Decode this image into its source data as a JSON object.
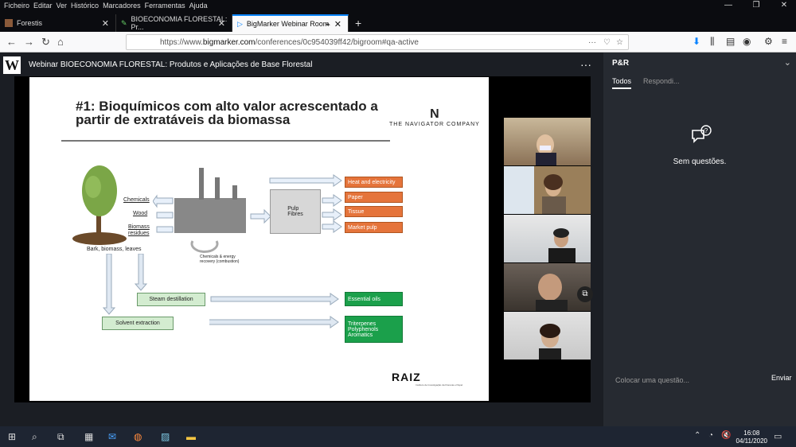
{
  "os_menu": {
    "items": [
      "Ficheiro",
      "Editar",
      "Ver",
      "Histórico",
      "Marcadores",
      "Ferramentas",
      "Ajuda"
    ]
  },
  "tabs": [
    {
      "label": "Forestis"
    },
    {
      "label": "BIOECONOMIA FLORESTAL: Pr..."
    },
    {
      "label": "BigMarker Webinar Room"
    }
  ],
  "browser": {
    "url_prefix": "https://www.",
    "url_domain": "bigmarker.com",
    "url_path": "/conferences/0c954039ff42/bigroom#qa-active",
    "url_more": "···"
  },
  "app": {
    "logo": "W",
    "title": "Webinar BIOECONOMIA FLORESTAL: Produtos e Aplicações de Base Florestal",
    "menu": "···"
  },
  "slide": {
    "title": "#1: Bioquímicos com alto valor acrescentado a partir de extratáveis da biomassa",
    "logo_name": "THE NAVIGATOR COMPANY",
    "logo_mark": "N",
    "inputs": [
      "Chemicals",
      "Wood",
      "Biomass residues"
    ],
    "tree_label": "Bark, biomass, leaves",
    "recovery_label": "Chemicals & energy recovery (combustion)",
    "pulp_label": "Pulp\nFibres",
    "outputs_orange": [
      "Heat and electricity",
      "Paper",
      "Tissue",
      "Market pulp"
    ],
    "steam": "Steam destillation",
    "solvent": "Solvent extraction",
    "essential": "Essential oils",
    "extracts": [
      "Triterpenes",
      "Polyphenols",
      "Aromatics"
    ],
    "raiz": "RAIZ",
    "raiz_sub": "Instituto de Investigação da Floresta e Papel"
  },
  "qa": {
    "title": "P&R",
    "tab_all": "Todos",
    "tab_answered": "Respondi...",
    "empty": "Sem questões.",
    "placeholder": "Colocar uma questão...",
    "send": "Enviar"
  },
  "taskbar": {
    "time": "16:08",
    "date": "04/11/2020"
  },
  "colors": {
    "accent": "#0a84ff",
    "orange": "#e5743b",
    "green": "#1ba04b"
  }
}
